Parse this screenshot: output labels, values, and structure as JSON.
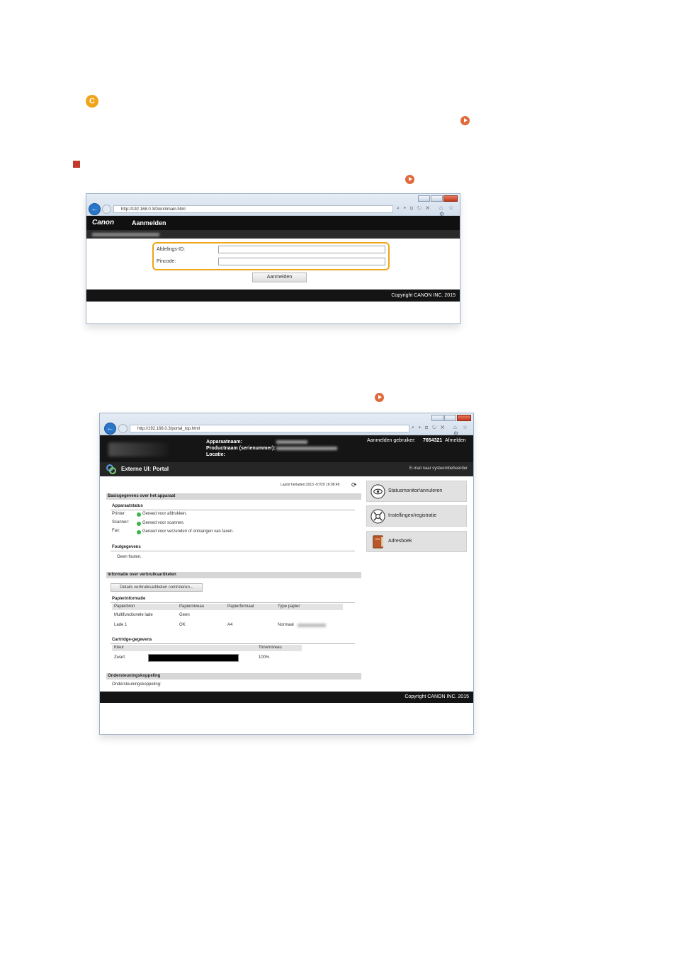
{
  "markers": {
    "badge_letter": "C"
  },
  "login_window": {
    "address": "http://192.168.0.3/0/en/i/main.html",
    "tools": "⌕ ▾ ⊡ ↻ ✕",
    "nav_icons": "⌂ ☆ ⚙",
    "brand": "Canon",
    "page_title": "Aanmelden",
    "sub_text": "MF810 Series / MF810 Series",
    "department_id_label": "Afdelings-ID:",
    "pincode_label": "Pincode:",
    "department_id_value": "",
    "pincode_value": "",
    "login_button": "Aanmelden",
    "copyright": "Copyright CANON INC. 2015"
  },
  "portal_window": {
    "address": "http://192.168.0.3/portal_top.html",
    "tools": "⌕ ▾ ⊡ ↻ ✕",
    "nav_icons": "⌂ ☆ ⚙",
    "device_name_label": "Apparaatnaam:",
    "product_name_label": "Productnaam (serienummer):",
    "location_label": "Locatie:",
    "login_user_label": "Aanmelden gebruiker:",
    "login_user_value": "7654321",
    "logout_link": "Afmelden",
    "portal_title": "Externe UI: Portal",
    "mail_admin_link": "E-mail naar systeembeheerder",
    "last_updated": "Laatst herladen:2015 -07/29 16:08:49",
    "sections": {
      "basic_info": "Basisgegevens over het apparaat",
      "device_status": "Apparaatstatus",
      "error_info": "Foutgegevens",
      "consumables": "Informatie over verbruiksartikelen",
      "paper_info": "Papierinformatie",
      "cartridge_info": "Cartridge-gegevens",
      "support": "Ondersteuningskoppeling"
    },
    "status_rows": [
      {
        "label": "Printer:",
        "value": "Gereed voor afdrukken."
      },
      {
        "label": "Scanner:",
        "value": "Gereed voor scannen."
      },
      {
        "label": "Fax:",
        "value": "Gereed voor verzenden of ontvangen van faxen."
      }
    ],
    "error_text": "Geen fouten.",
    "consumables_button": "Details verbruiksartikelen controleren...",
    "paper_table": {
      "headers": [
        "Papierbron",
        "Papierniveau",
        "Papierformaat",
        "Type papier"
      ],
      "rows": [
        [
          "Multifunctionele lade",
          "Geen",
          "",
          ""
        ],
        [
          "Lade 1",
          "OK",
          "A4",
          "Normaal"
        ]
      ]
    },
    "cartridge_table": {
      "headers": [
        "Kleur",
        "Tonerniveau"
      ],
      "rows": [
        {
          "color": "Zwart",
          "level": "100%",
          "level_fraction": 1.0
        }
      ]
    },
    "support_text": "Ondersteuningskoppeling:",
    "side_buttons": [
      {
        "label": "Statusmonitor/annuleren",
        "icon": "monitor-icon"
      },
      {
        "label": "Instellingen/registratie",
        "icon": "settings-icon"
      },
      {
        "label": "Adresboek",
        "icon": "address-book-icon"
      }
    ],
    "copyright": "Copyright CANON INC. 2015"
  },
  "colors": {
    "accent_orange": "#f0a419",
    "marker_red": "#c0392b",
    "status_green": "#3ab54a",
    "header_black": "#151515"
  }
}
